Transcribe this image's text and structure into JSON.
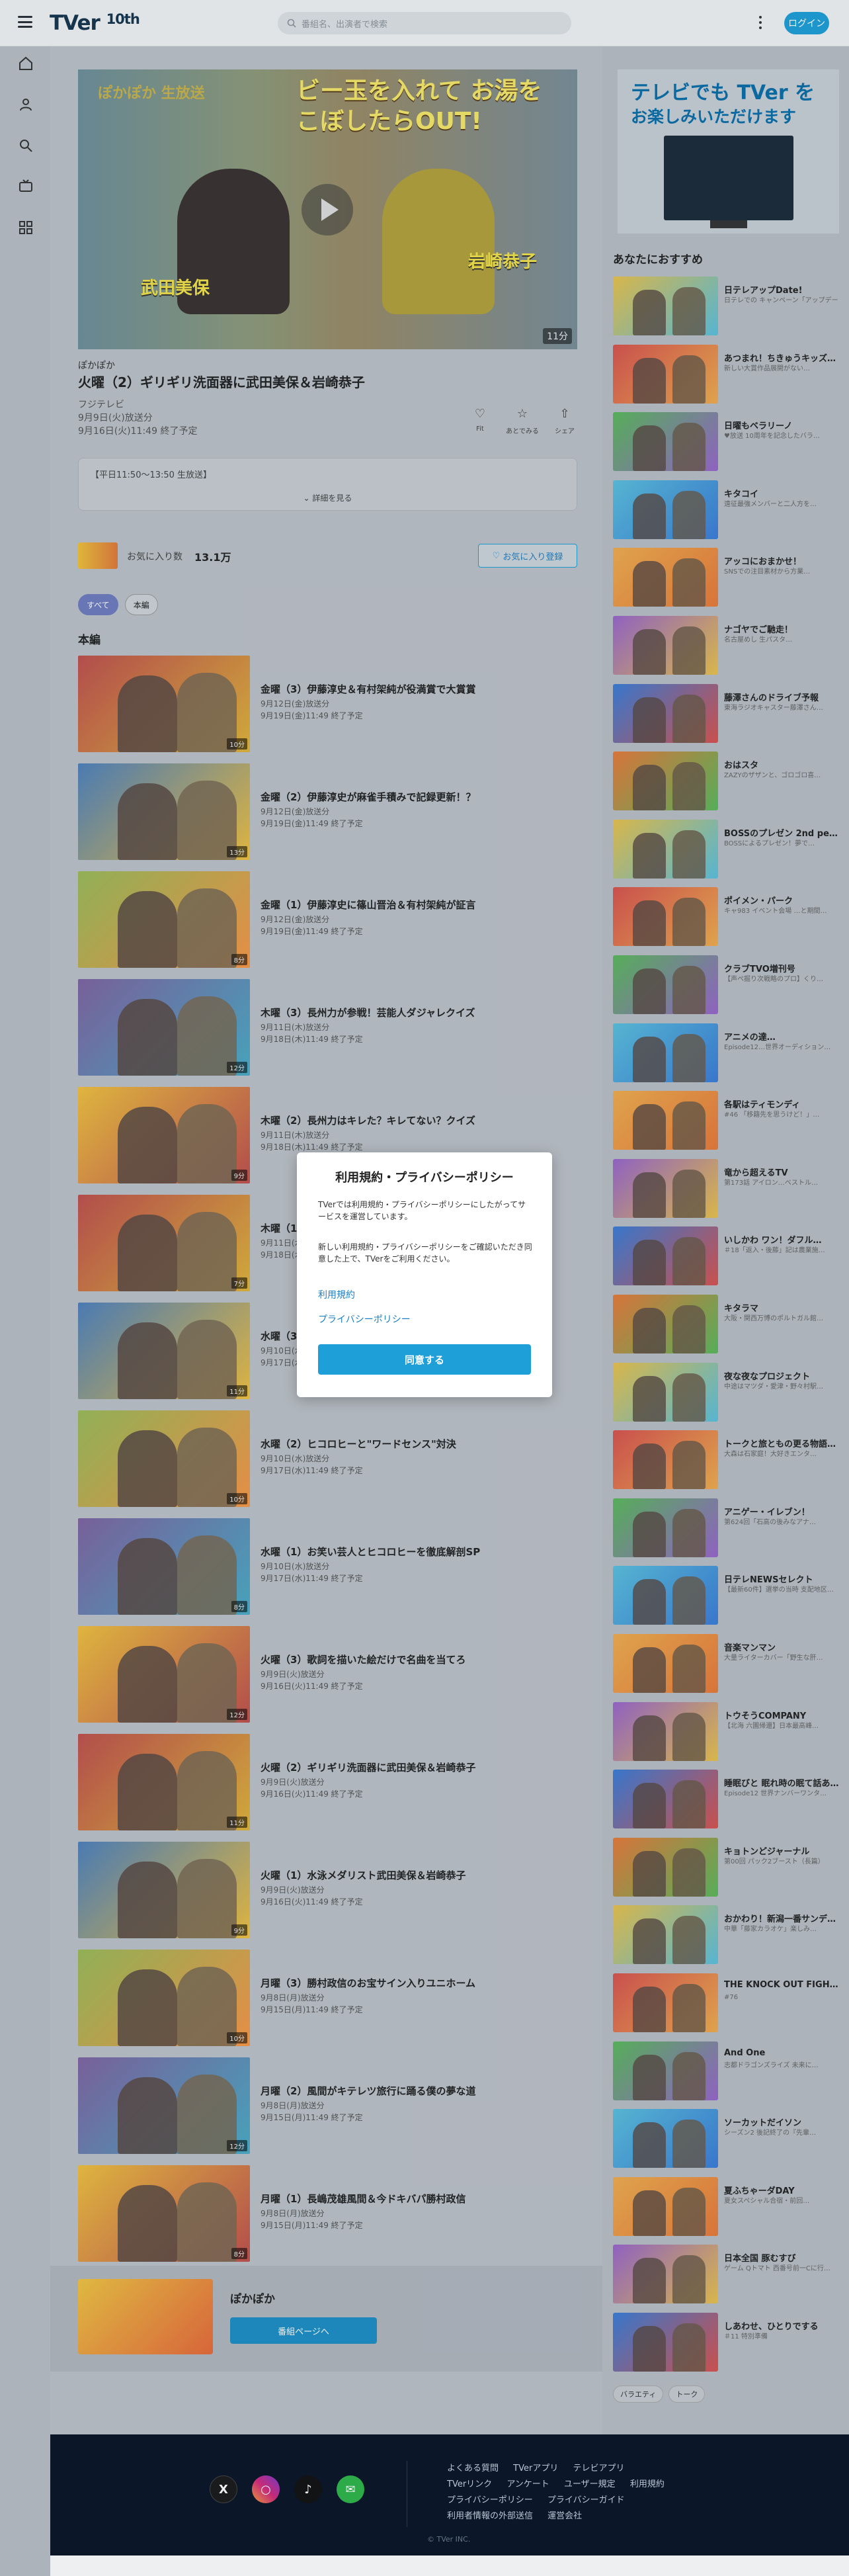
{
  "header": {
    "logo_text": "TVer",
    "logo_sub": "10th",
    "search_placeholder": "番組名、出演者で検索",
    "login_label": "ログイン"
  },
  "sidebar": [
    "home-icon",
    "user-icon",
    "search-icon",
    "tv-icon",
    "grid-icon"
  ],
  "player": {
    "overlay_title_left": "ぽかぽか 生放送",
    "overlay_title_right": "ビー玉を入れて お湯をこぼしたらOUT!",
    "name_left": "武田美保",
    "name_right": "岩崎恭子",
    "duration": "11分"
  },
  "episode": {
    "series": "ぽかぽか",
    "title": "火曜（2）ギリギリ洗面器に武田美保＆岩崎恭子",
    "broadcaster": "フジテレビ",
    "aired": "9月9日(火)放送分",
    "expires": "9月16日(火)11:49 終了予定",
    "description": "【平日11:50〜13:50 生放送】",
    "more": "詳細を見る",
    "actions": [
      {
        "label": "Fit",
        "icon": "thumb-icon"
      },
      {
        "label": "あとでみる",
        "icon": "star-icon"
      },
      {
        "label": "シェア",
        "icon": "share-icon"
      }
    ]
  },
  "favorite": {
    "label": "お気に入り数",
    "count": "13.1万",
    "button": "お気に入り登録"
  },
  "tabs": [
    "すべて",
    "本編"
  ],
  "section_title": "本編",
  "episodes": [
    {
      "title": "金曜（3）伊藤淳史＆有村架純が役満賞で大賞賞",
      "aired": "9月12日(金)放送分",
      "expires": "9月19日(金)11:49 終了予定",
      "dur": "10分"
    },
    {
      "title": "金曜（2）伊藤淳史が麻雀手積みで記録更新！？",
      "aired": "9月12日(金)放送分",
      "expires": "9月19日(金)11:49 終了予定",
      "dur": "13分"
    },
    {
      "title": "金曜（1）伊藤淳史に篠山晋治＆有村架純が証言",
      "aired": "9月12日(金)放送分",
      "expires": "9月19日(金)11:49 終了予定",
      "dur": "8分"
    },
    {
      "title": "木曜（3）長州力が参戦！芸能人ダジャレクイズ",
      "aired": "9月11日(木)放送分",
      "expires": "9月18日(木)11:49 終了予定",
      "dur": "12分"
    },
    {
      "title": "木曜（2）長州力はキレた？キレてない？クイズ",
      "aired": "9月11日(木)放送分",
      "expires": "9月18日(木)11:49 終了予定",
      "dur": "9分"
    },
    {
      "title": "木曜（1）",
      "aired": "9月11日(木)放送分",
      "expires": "9月18日(木)11:49 終了予定",
      "dur": "7分"
    },
    {
      "title": "水曜（3）",
      "aired": "9月10日(水)放送分",
      "expires": "9月17日(水)11:49 終了予定",
      "dur": "11分"
    },
    {
      "title": "水曜（2）ヒコロヒーと\"ワードセンス\"対決",
      "aired": "9月10日(水)放送分",
      "expires": "9月17日(水)11:49 終了予定",
      "dur": "10分"
    },
    {
      "title": "水曜（1）お笑い芸人とヒコロヒーを徹底解剖SP",
      "aired": "9月10日(水)放送分",
      "expires": "9月17日(水)11:49 終了予定",
      "dur": "8分"
    },
    {
      "title": "火曜（3）歌詞を描いた絵だけで名曲を当てろ",
      "aired": "9月9日(火)放送分",
      "expires": "9月16日(火)11:49 終了予定",
      "dur": "12分"
    },
    {
      "title": "火曜（2）ギリギリ洗面器に武田美保＆岩崎恭子",
      "aired": "9月9日(火)放送分",
      "expires": "9月16日(火)11:49 終了予定",
      "dur": "11分"
    },
    {
      "title": "火曜（1）水泳メダリスト武田美保＆岩崎恭子",
      "aired": "9月9日(火)放送分",
      "expires": "9月16日(火)11:49 終了予定",
      "dur": "9分"
    },
    {
      "title": "月曜（3）勝村政信のお宝サイン入りユニホーム",
      "aired": "9月8日(月)放送分",
      "expires": "9月15日(月)11:49 終了予定",
      "dur": "10分"
    },
    {
      "title": "月曜（2）風間がキテレツ旅行に踊る僕の夢な道",
      "aired": "9月8日(月)放送分",
      "expires": "9月15日(月)11:49 終了予定",
      "dur": "12分"
    },
    {
      "title": "月曜（1）長嶋茂雄風間＆今ドキバパ勝村政信",
      "aired": "9月8日(月)放送分",
      "expires": "9月15日(月)11:49 終了予定",
      "dur": "8分"
    }
  ],
  "promo": {
    "name": "ぽかぽか",
    "button": "番組ページへ"
  },
  "banner": {
    "line1": "テレビでも TVer を",
    "line2": "お楽しみいただけます"
  },
  "recommend_title": "あなたにおすすめ",
  "recommend": [
    {
      "title": "日テレアップDate!",
      "sub": "日テレでの キャンペーン「アップデート」"
    },
    {
      "title": "あつまれ！ちきゅうキッズ…",
      "sub": "新しい大賞作品展開がない…"
    },
    {
      "title": "日曜もベラリーノ",
      "sub": "♥放送 10周年を記念したバラ…"
    },
    {
      "title": "キタコイ",
      "sub": "遠征最強メンバーと二人方を…"
    },
    {
      "title": "アッコにおまかせ！",
      "sub": "SNSでの注目素材から方業…"
    },
    {
      "title": "ナゴヤでご馳走！",
      "sub": "名古屋めし 生パスタ…"
    },
    {
      "title": "藤澤さんのドライブ予報",
      "sub": "東海ラジオキャスター藤澤さん…"
    },
    {
      "title": "おはスタ",
      "sub": "ZAZYのザザンと、ゴロゴロ喜…"
    },
    {
      "title": "BOSSのプレゼン 2nd pe…",
      "sub": "BOSSによるプレゼン！夢で…"
    },
    {
      "title": "ポイメン・パーク",
      "sub": "キャ983 イベント会場 …と期間…"
    },
    {
      "title": "クラブTVO増刊号",
      "sub": "【声ペ掘り次戦略のプロ】くり…"
    },
    {
      "title": "アニメの達…",
      "sub": "Episode12…世界オーディション…"
    },
    {
      "title": "各駅はティモンディ",
      "sub": "#46 「移籍先を思うけど！」…"
    },
    {
      "title": "竜から超えるTV",
      "sub": "第173話 アイロン…ベストル…"
    },
    {
      "title": "いしかわ ワン！ダフル…",
      "sub": "＃18「返入・後藤」記は農業施…"
    },
    {
      "title": "キタラマ",
      "sub": "大阪・関西万博のポルトガル館…"
    },
    {
      "title": "夜な夜なプロジェクト",
      "sub": "中途はマツダ・愛津・野々村駅…"
    },
    {
      "title": "トークと旅ともの更る物語…",
      "sub": "大森は石家庭！大好きエンタ…"
    },
    {
      "title": "アニゲー・イレブン！",
      "sub": "第624回「石高の後みなアナ…"
    },
    {
      "title": "日テレNEWSセレクト",
      "sub": "【最新60件】選挙の当時 支配地区…"
    },
    {
      "title": "音楽マンマン",
      "sub": "大量ライターカバー「野生な肝…"
    },
    {
      "title": "トウそうCOMPANY",
      "sub": "【北海 六園帰還】日本最高峰…"
    },
    {
      "title": "睡眠びと 眠れ時の眠て話あ…",
      "sub": "Episode12 世界ナンバーワンタ…"
    },
    {
      "title": "キョトンどジャーナル",
      "sub": "第00回 パック2ブースト（長篇）"
    },
    {
      "title": "おかわり！新潟一番サンデ…",
      "sub": "中華「藤家カラオケ」楽しみ…"
    },
    {
      "title": "THE KNOCK OUT FIGH…",
      "sub": "#76"
    },
    {
      "title": "And One",
      "sub": "志都ドラゴンズライズ 未来に…"
    },
    {
      "title": "ソーカットだイソン",
      "sub": "シーズン2 後記終了の『先輩…"
    },
    {
      "title": "夏ふちゃーダDAY",
      "sub": "夏女スペシャル合宿・前回…"
    },
    {
      "title": "日本全国 豚むすび",
      "sub": "ゲーム Qトマト 西番号前一Cに行…"
    },
    {
      "title": "しあわせ、ひとりでする",
      "sub": "＃11 特別準備"
    }
  ],
  "chips": [
    "バラエティ",
    "トーク"
  ],
  "footer": {
    "links": [
      "よくある質問",
      "TVerアプリ",
      "テレビアプリ",
      "TVerリンク",
      "アンケート",
      "ユーザー規定",
      "利用規約",
      "プライバシーポリシー",
      "プライバシーガイド",
      "利用者情報の外部送信",
      "運営会社"
    ],
    "copyright": "© TVer INC."
  },
  "modal": {
    "title": "利用規約・プライバシーポリシー",
    "text1": "TVerでは利用規約・プライバシーポリシーにしたがってサービスを運営しています。",
    "text2": "新しい利用規約・プライバシーポリシーをご確認いただき同意した上で、TVerをご利用ください。",
    "link1": "利用規約",
    "link2": "プライバシーポリシー",
    "agree": "同意する"
  }
}
